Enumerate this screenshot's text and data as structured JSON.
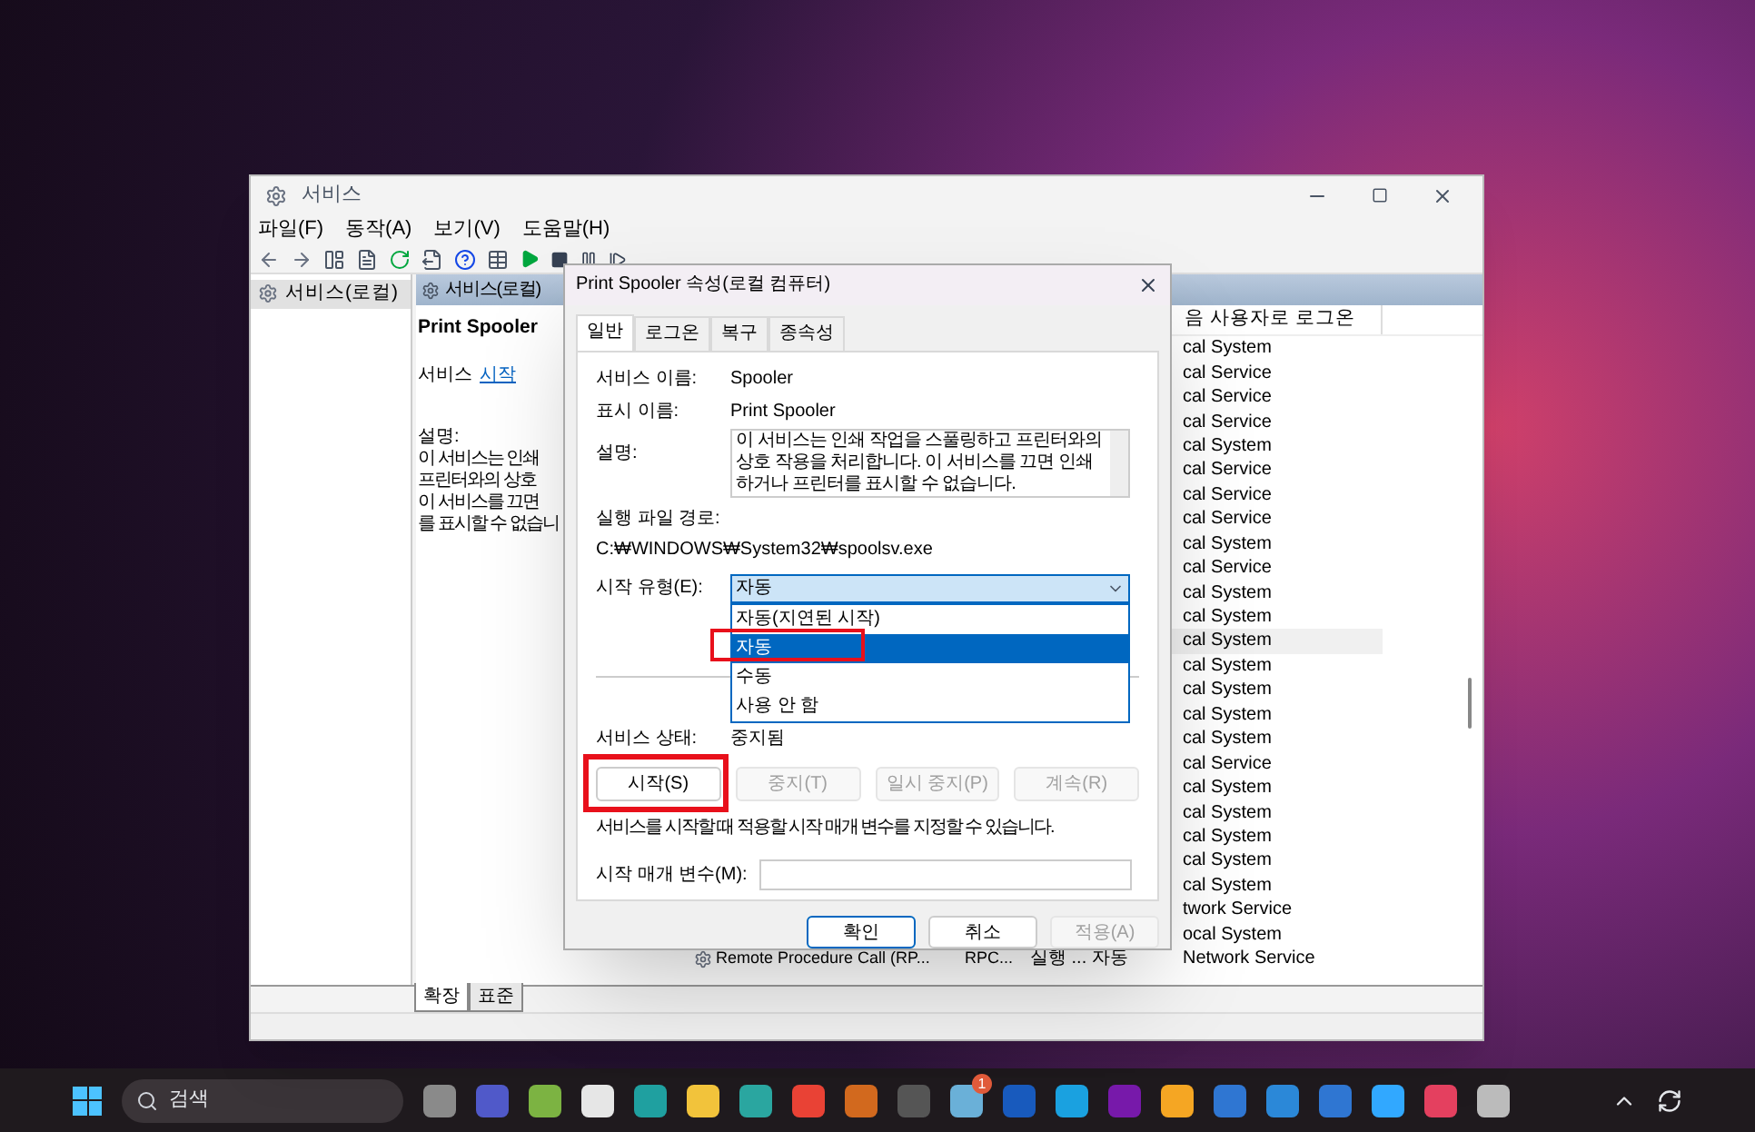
{
  "services_window": {
    "title": "서비스",
    "menu": [
      "파일(F)",
      "동작(A)",
      "보기(V)",
      "도움말(H)"
    ],
    "tree": [
      {
        "label": "서비스(로컬)",
        "selected": true
      }
    ],
    "panel_header": "서비스(로컬)",
    "detail": {
      "name": "Print Spooler",
      "action_prefix": "서비스",
      "action_link": "시작",
      "description_label": "설명:",
      "description_lines": [
        "이 서비스는 인쇄",
        "프린터와의 상호",
        "이 서비스를 끄면",
        "를 표시할 수 없습니"
      ]
    },
    "list": {
      "column_header": "음 사용자로 로그온",
      "rows": [
        {
          "logon": "cal System",
          "selected": false
        },
        {
          "logon": "cal Service",
          "selected": false
        },
        {
          "logon": "cal Service",
          "selected": false
        },
        {
          "logon": "cal Service",
          "selected": false
        },
        {
          "logon": "cal System",
          "selected": false
        },
        {
          "logon": "cal Service",
          "selected": false
        },
        {
          "logon": "cal Service",
          "selected": false
        },
        {
          "logon": "cal Service",
          "selected": false
        },
        {
          "logon": "cal System",
          "selected": false
        },
        {
          "logon": "cal Service",
          "selected": false
        },
        {
          "logon": "cal System",
          "selected": false
        },
        {
          "logon": "cal System",
          "selected": false
        },
        {
          "logon": "cal System",
          "selected": true
        },
        {
          "logon": "cal System",
          "selected": false
        },
        {
          "logon": "cal System",
          "selected": false
        },
        {
          "logon": "cal System",
          "selected": false
        },
        {
          "logon": "cal System",
          "selected": false
        },
        {
          "logon": "cal Service",
          "selected": false
        },
        {
          "logon": "cal System",
          "selected": false
        },
        {
          "logon": "cal System",
          "selected": false
        },
        {
          "logon": "cal System",
          "selected": false
        },
        {
          "logon": "cal System",
          "selected": false
        },
        {
          "logon": "cal System",
          "selected": false
        },
        {
          "logon": "twork Service",
          "selected": false
        },
        {
          "logon": "ocal System",
          "selected": false
        },
        {
          "name": "Remote Procedure Call (RP...",
          "description": "RPC...",
          "status": "실행 ...",
          "startup": "자동",
          "logon": "Network Service",
          "selected": false
        }
      ]
    },
    "view_tabs": [
      {
        "label": "확장",
        "selected": true
      },
      {
        "label": "표준",
        "selected": false
      }
    ]
  },
  "dialog": {
    "title": "Print Spooler 속성(로컬 컴퓨터)",
    "tabs": [
      {
        "label": "일반",
        "selected": true
      },
      {
        "label": "로그온",
        "selected": false
      },
      {
        "label": "복구",
        "selected": false
      },
      {
        "label": "종속성",
        "selected": false
      }
    ],
    "service_name_label": "서비스 이름:",
    "service_name": "Spooler",
    "display_name_label": "표시 이름:",
    "display_name": "Print Spooler",
    "description_label": "설명:",
    "description": "이 서비스는 인쇄 작업을 스풀링하고 프린터와의 상호 작용을 처리합니다. 이 서비스를 끄면 인쇄하거나 프린터를 표시할 수 없습니다.",
    "path_label": "실행 파일 경로:",
    "path": "C:₩WINDOWS₩System32₩spoolsv.exe",
    "startup_label": "시작 유형(E):",
    "startup_value": "자동",
    "startup_options": [
      {
        "label": "자동(지연된 시작)",
        "selected": false
      },
      {
        "label": "자동",
        "selected": true
      },
      {
        "label": "수동",
        "selected": false
      },
      {
        "label": "사용 안 함",
        "selected": false
      }
    ],
    "status_label": "서비스 상태:",
    "status": "중지됨",
    "control_buttons": [
      {
        "label": "시작(S)",
        "disabled": false
      },
      {
        "label": "중지(T)",
        "disabled": true
      },
      {
        "label": "일시 중지(P)",
        "disabled": true
      },
      {
        "label": "계속(R)",
        "disabled": true
      }
    ],
    "hint": "서비스를 시작할 때 적용할 시작 매개 변수를 지정할 수 있습니다.",
    "params_label": "시작 매개 변수(M):",
    "footer_buttons": [
      {
        "label": "확인",
        "disabled": false
      },
      {
        "label": "취소",
        "disabled": false
      },
      {
        "label": "적용(A)",
        "disabled": true
      }
    ]
  },
  "taskbar": {
    "search_placeholder": "검색",
    "badge": "1"
  }
}
